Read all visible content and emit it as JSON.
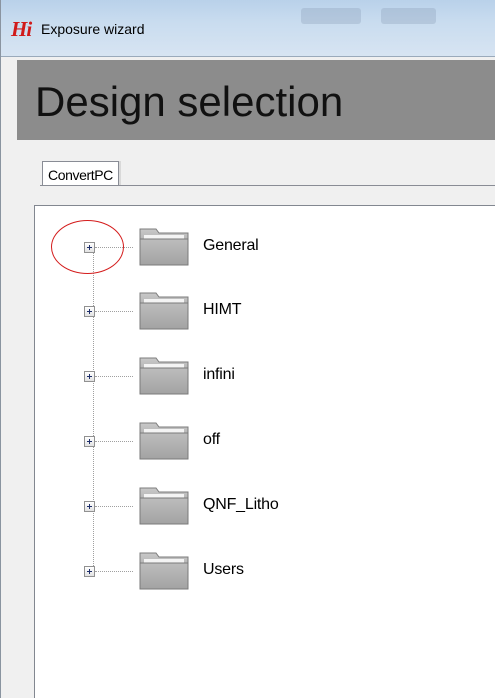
{
  "window": {
    "app_icon_text": "Hi",
    "title": "Exposure wizard"
  },
  "header": {
    "title": "Design selection"
  },
  "tabs": [
    {
      "label": "ConvertPC",
      "selected": true
    }
  ],
  "tree": {
    "nodes": [
      {
        "label": "General",
        "icon": "folder-icon",
        "expanded": false,
        "highlighted": true
      },
      {
        "label": "HIMT",
        "icon": "folder-icon",
        "expanded": false
      },
      {
        "label": "infini",
        "icon": "folder-icon",
        "expanded": false
      },
      {
        "label": "off",
        "icon": "folder-icon",
        "expanded": false
      },
      {
        "label": "QNF_Litho",
        "icon": "folder-icon",
        "expanded": false
      },
      {
        "label": "Users",
        "icon": "folder-icon",
        "expanded": false
      }
    ]
  },
  "colors": {
    "header_band": "#8c8c8c",
    "app_icon": "#d11a1a",
    "highlight_circle": "#d41c1c"
  }
}
